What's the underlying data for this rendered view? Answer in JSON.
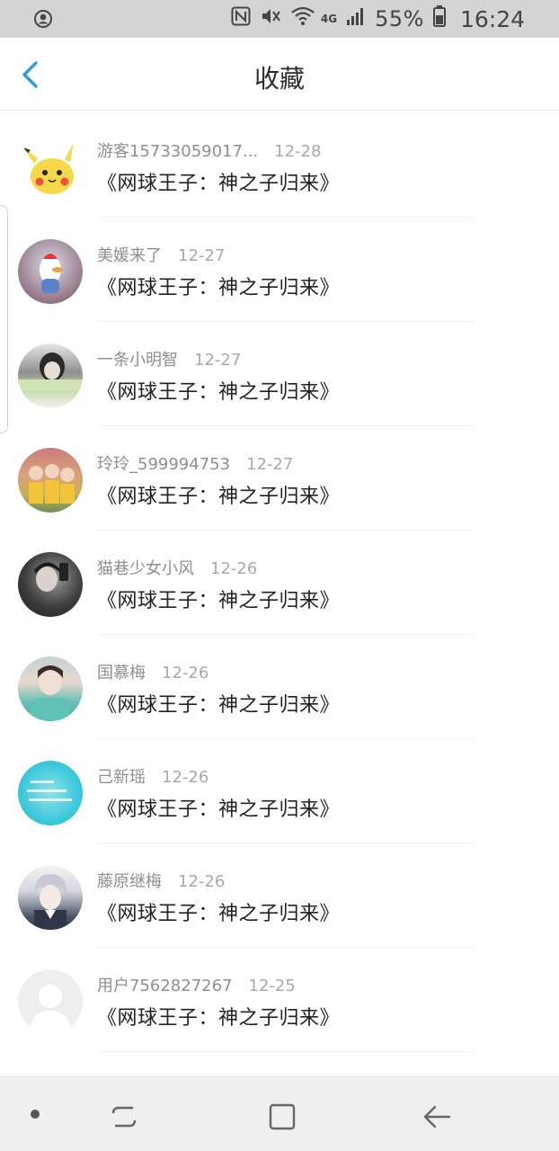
{
  "status_bar": {
    "battery_percent": "55%",
    "time": "16:24",
    "network": "4G",
    "icons": [
      "account-circle-icon",
      "nfc-icon",
      "mute-icon",
      "wifi-icon",
      "signal-icon",
      "battery-icon"
    ]
  },
  "header": {
    "title": "收藏",
    "back_icon": "chevron-left-icon",
    "accent_color": "#2f9be6"
  },
  "list": {
    "items": [
      {
        "user": "游客15733059017...",
        "date": "12-28",
        "work": "《网球王子：神之子归来》",
        "avatar": "pikachu-avatar"
      },
      {
        "user": "美媛来了",
        "date": "12-27",
        "work": "《网球王子：神之子归来》",
        "avatar": "photo-avatar"
      },
      {
        "user": "一条小明智",
        "date": "12-27",
        "work": "《网球王子：神之子归来》",
        "avatar": "photo-avatar"
      },
      {
        "user": "玲玲_599994753",
        "date": "12-27",
        "work": "《网球王子：神之子归来》",
        "avatar": "photo-avatar"
      },
      {
        "user": "猫巷少女小风",
        "date": "12-26",
        "work": "《网球王子：神之子归来》",
        "avatar": "photo-avatar"
      },
      {
        "user": "国慕梅",
        "date": "12-26",
        "work": "《网球王子：神之子归来》",
        "avatar": "photo-avatar"
      },
      {
        "user": "己新瑶",
        "date": "12-26",
        "work": "《网球王子：神之子归来》",
        "avatar": "photo-avatar"
      },
      {
        "user": "藤原继梅",
        "date": "12-26",
        "work": "《网球王子：神之子归来》",
        "avatar": "anime-avatar"
      },
      {
        "user": "用户7562827267",
        "date": "12-25",
        "work": "《网球王子：神之子归来》",
        "avatar": "default-avatar"
      }
    ]
  },
  "nav_bar": {
    "icons": [
      "dot-icon",
      "recent-apps-icon",
      "home-icon",
      "back-icon"
    ]
  }
}
